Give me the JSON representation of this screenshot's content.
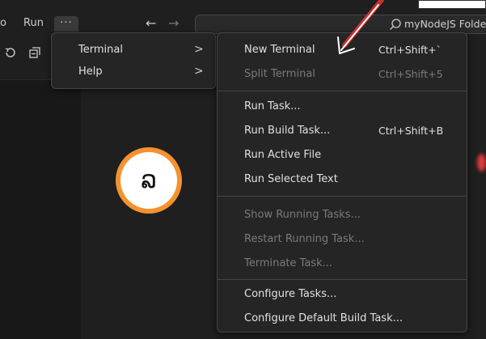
{
  "titlebar": {
    "menu_partial": "o",
    "menu_run": "Run",
    "more_label": "···",
    "back_icon": "arrow-left-icon",
    "forward_icon": "arrow-right-icon",
    "search_text": "myNodeJS Folder"
  },
  "menu": {
    "items": [
      {
        "label": "Terminal",
        "chevron": ">"
      },
      {
        "label": "Help",
        "chevron": ">"
      }
    ]
  },
  "terminal_menu": {
    "items": [
      {
        "label": "New Terminal",
        "shortcut": "Ctrl+Shift+`",
        "enabled": true
      },
      {
        "label": "Split Terminal",
        "shortcut": "Ctrl+Shift+5",
        "enabled": false
      },
      {
        "label": "Run Task...",
        "shortcut": "",
        "enabled": true
      },
      {
        "label": "Run Build Task...",
        "shortcut": "Ctrl+Shift+B",
        "enabled": true
      },
      {
        "label": "Run Active File",
        "shortcut": "",
        "enabled": true
      },
      {
        "label": "Run Selected Text",
        "shortcut": "",
        "enabled": true
      },
      {
        "label": "Show Running Tasks...",
        "shortcut": "",
        "enabled": false
      },
      {
        "label": "Restart Running Task...",
        "shortcut": "",
        "enabled": false
      },
      {
        "label": "Terminate Task...",
        "shortcut": "",
        "enabled": false
      },
      {
        "label": "Configure Tasks...",
        "shortcut": "",
        "enabled": true
      },
      {
        "label": "Configure Default Build Task...",
        "shortcut": "",
        "enabled": true
      }
    ]
  },
  "annotation": {
    "step_glyph": "ລ",
    "badge_color": "#f4922f",
    "arrow_color": "#e8332f"
  },
  "colors": {
    "background": "#1f1f1f",
    "menu_bg": "#252526",
    "text": "#e0e0e0",
    "disabled_text": "#7a7a7a"
  }
}
